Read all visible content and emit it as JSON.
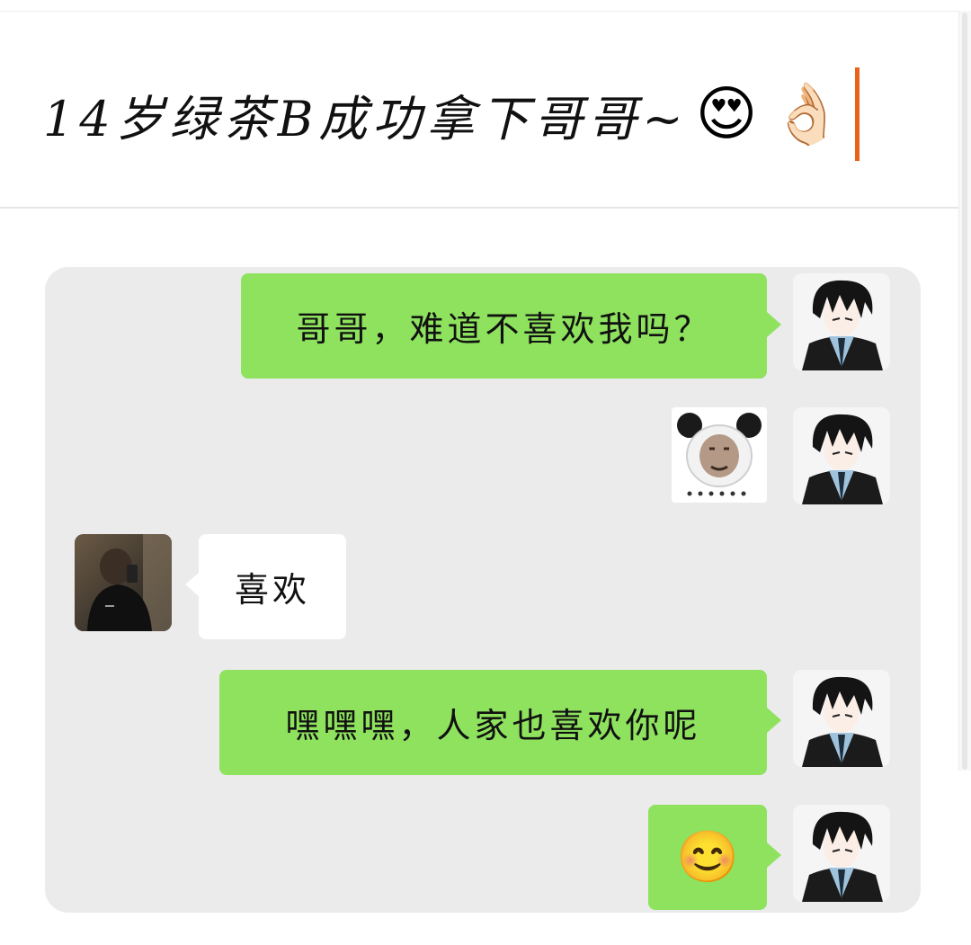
{
  "header": {
    "title": "14岁绿茶B成功拿下哥哥~",
    "emojis": [
      "😍",
      "👌🏻"
    ],
    "caret_color": "#e8641b"
  },
  "chat": {
    "background": "#ebebeb",
    "sent_bubble_color": "#8ee25e",
    "received_bubble_color": "#ffffff",
    "messages": [
      {
        "sender": "me",
        "type": "text",
        "text": "哥哥，难道不喜欢我吗？",
        "avatar": "anime-boy-avatar"
      },
      {
        "sender": "me",
        "type": "sticker",
        "sticker": "panda-meme-sticker",
        "avatar": "anime-boy-avatar"
      },
      {
        "sender": "them",
        "type": "text",
        "text": "喜欢",
        "avatar": "mirror-selfie-avatar"
      },
      {
        "sender": "me",
        "type": "text",
        "text": "嘿嘿嘿，人家也喜欢你呢",
        "avatar": "anime-boy-avatar"
      },
      {
        "sender": "me",
        "type": "emoji",
        "text": "😊",
        "avatar": "anime-boy-avatar"
      }
    ]
  }
}
